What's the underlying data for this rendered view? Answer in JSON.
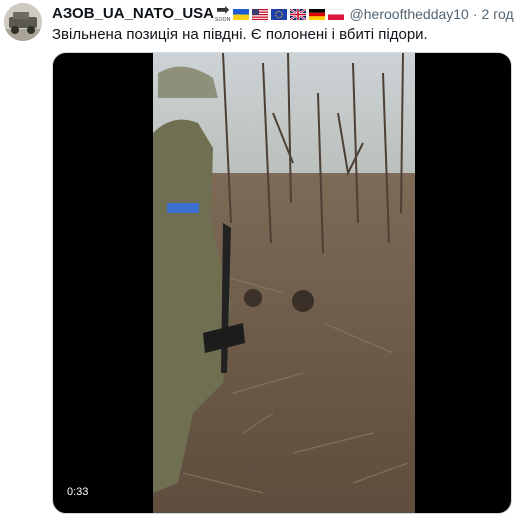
{
  "tweet": {
    "display_name": "АЗОВ_UA_NATO_USA",
    "soon_label": "SOON",
    "flags": [
      "ukraine-flag",
      "usa-flag",
      "eu-flag",
      "uk-flag",
      "germany-flag",
      "poland-flag"
    ],
    "handle": "@heroofthedday10",
    "separator": "·",
    "time": "2 год",
    "text": "Звільнена позиція на півдні. Є полонені і вбиті підори."
  },
  "video": {
    "duration": "0:33"
  }
}
